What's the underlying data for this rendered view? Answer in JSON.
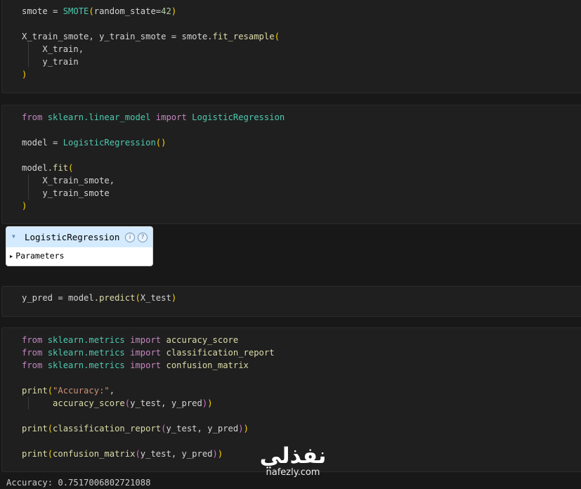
{
  "cells": {
    "cell1": {
      "lines": [
        [
          [
            "t-var",
            "smote"
          ],
          [
            "t-txt",
            " = "
          ],
          [
            "t-fn",
            "SMOTE"
          ],
          [
            "t-par",
            "("
          ],
          [
            "t-var",
            "random_state"
          ],
          [
            "t-txt",
            "="
          ],
          [
            "t-num",
            "42"
          ],
          [
            "t-par",
            ")"
          ]
        ],
        [],
        [
          [
            "t-var",
            "X_train_smote"
          ],
          [
            "t-txt",
            ", "
          ],
          [
            "t-var",
            "y_train_smote"
          ],
          [
            "t-txt",
            " = "
          ],
          [
            "t-var",
            "smote"
          ],
          [
            "t-txt",
            "."
          ],
          [
            "t-call",
            "fit_resample"
          ],
          [
            "t-par",
            "("
          ]
        ],
        [
          [
            "t-txt",
            "    "
          ],
          [
            "t-var",
            "X_train"
          ],
          [
            "t-txt",
            ","
          ]
        ],
        [
          [
            "t-txt",
            "    "
          ],
          [
            "t-var",
            "y_train"
          ]
        ],
        [
          [
            "t-par",
            ")"
          ]
        ]
      ]
    },
    "cell2": {
      "lines": [
        [
          [
            "t-kw",
            "from"
          ],
          [
            "t-txt",
            " "
          ],
          [
            "t-mod",
            "sklearn.linear_model"
          ],
          [
            "t-txt",
            " "
          ],
          [
            "t-kw",
            "import"
          ],
          [
            "t-txt",
            " "
          ],
          [
            "t-fn",
            "LogisticRegression"
          ]
        ],
        [],
        [
          [
            "t-var",
            "model"
          ],
          [
            "t-txt",
            " = "
          ],
          [
            "t-fn",
            "LogisticRegression"
          ],
          [
            "t-par",
            "()"
          ]
        ],
        [],
        [
          [
            "t-var",
            "model"
          ],
          [
            "t-txt",
            "."
          ],
          [
            "t-call",
            "fit"
          ],
          [
            "t-par",
            "("
          ]
        ],
        [
          [
            "t-txt",
            "    "
          ],
          [
            "t-var",
            "X_train_smote"
          ],
          [
            "t-txt",
            ","
          ]
        ],
        [
          [
            "t-txt",
            "    "
          ],
          [
            "t-var",
            "y_train_smote"
          ]
        ],
        [
          [
            "t-par",
            ")"
          ]
        ]
      ]
    },
    "cell3": {
      "lines": [
        [
          [
            "t-var",
            "y_pred"
          ],
          [
            "t-txt",
            " = "
          ],
          [
            "t-var",
            "model"
          ],
          [
            "t-txt",
            "."
          ],
          [
            "t-call",
            "predict"
          ],
          [
            "t-par",
            "("
          ],
          [
            "t-var",
            "X_test"
          ],
          [
            "t-par",
            ")"
          ]
        ]
      ]
    },
    "cell4": {
      "lines": [
        [
          [
            "t-kw",
            "from"
          ],
          [
            "t-txt",
            " "
          ],
          [
            "t-mod",
            "sklearn.metrics"
          ],
          [
            "t-txt",
            " "
          ],
          [
            "t-kw",
            "import"
          ],
          [
            "t-txt",
            " "
          ],
          [
            "t-call",
            "accuracy_score"
          ]
        ],
        [
          [
            "t-kw",
            "from"
          ],
          [
            "t-txt",
            " "
          ],
          [
            "t-mod",
            "sklearn.metrics"
          ],
          [
            "t-txt",
            " "
          ],
          [
            "t-kw",
            "import"
          ],
          [
            "t-txt",
            " "
          ],
          [
            "t-call",
            "classification_report"
          ]
        ],
        [
          [
            "t-kw",
            "from"
          ],
          [
            "t-txt",
            " "
          ],
          [
            "t-mod",
            "sklearn.metrics"
          ],
          [
            "t-txt",
            " "
          ],
          [
            "t-kw",
            "import"
          ],
          [
            "t-txt",
            " "
          ],
          [
            "t-call",
            "confusion_matrix"
          ]
        ],
        [],
        [
          [
            "t-call",
            "print"
          ],
          [
            "t-par",
            "("
          ],
          [
            "t-str",
            "\"Accuracy:\""
          ],
          [
            "t-txt",
            ","
          ]
        ],
        [
          [
            "t-txt",
            "      "
          ],
          [
            "t-call",
            "accuracy_score"
          ],
          [
            "t-par2",
            "("
          ],
          [
            "t-var",
            "y_test"
          ],
          [
            "t-txt",
            ", "
          ],
          [
            "t-var",
            "y_pred"
          ],
          [
            "t-par2",
            ")"
          ],
          [
            "t-par",
            ")"
          ]
        ],
        [],
        [
          [
            "t-call",
            "print"
          ],
          [
            "t-par",
            "("
          ],
          [
            "t-call",
            "classification_report"
          ],
          [
            "t-par2",
            "("
          ],
          [
            "t-var",
            "y_test"
          ],
          [
            "t-txt",
            ", "
          ],
          [
            "t-var",
            "y_pred"
          ],
          [
            "t-par2",
            ")"
          ],
          [
            "t-par",
            ")"
          ]
        ],
        [],
        [
          [
            "t-call",
            "print"
          ],
          [
            "t-par",
            "("
          ],
          [
            "t-call",
            "confusion_matrix"
          ],
          [
            "t-par2",
            "("
          ],
          [
            "t-var",
            "y_test"
          ],
          [
            "t-txt",
            ", "
          ],
          [
            "t-var",
            "y_pred"
          ],
          [
            "t-par2",
            ")"
          ],
          [
            "t-par",
            ")"
          ]
        ]
      ]
    }
  },
  "widget": {
    "title": "LogisticRegression",
    "info_label": "i",
    "help_label": "?",
    "parameters_label": "Parameters"
  },
  "watermark": {
    "arabic": "نفذلي",
    "latin": "nafezly.com"
  },
  "output": {
    "accuracy_line": "Accuracy: 0.7517006802721088"
  }
}
